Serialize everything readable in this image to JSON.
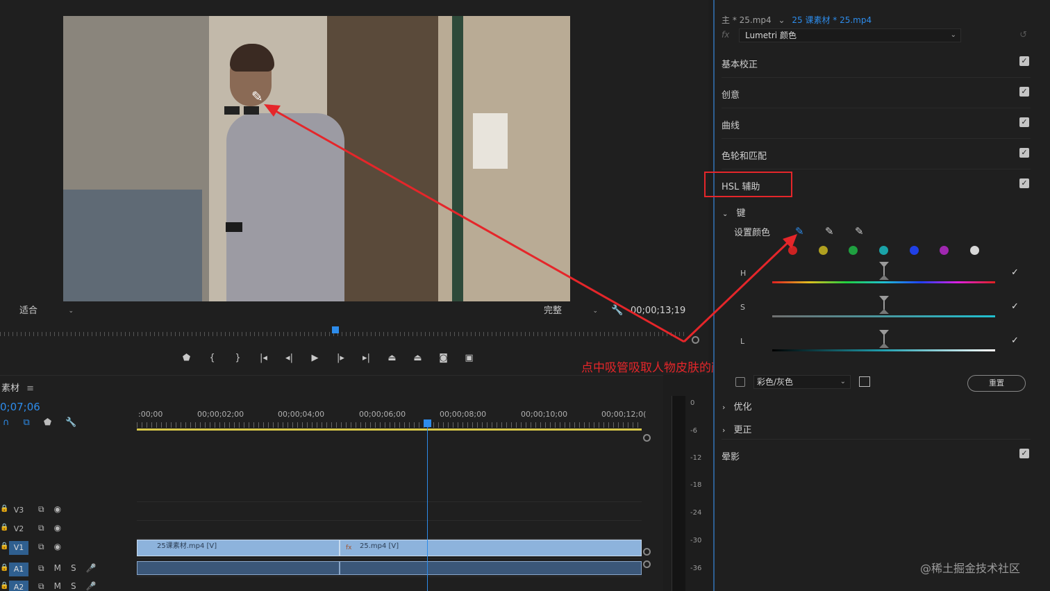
{
  "monitor": {
    "fit_label": "适合",
    "quality_label": "完整",
    "timecode": "00;00;13;19"
  },
  "annotation": {
    "text": "点中吸管吸取人物皮肤的颜色"
  },
  "transport": {
    "buttons": [
      "marker-icon",
      "in-point-icon",
      "out-point-icon",
      "go-to-in-icon",
      "step-back-icon",
      "play-icon",
      "step-forward-icon",
      "go-to-out-icon",
      "lift-icon",
      "extract-icon",
      "camera-icon",
      "compare-icon"
    ]
  },
  "timeline": {
    "title": "素材",
    "menu_glyph": "≡",
    "current_time": "0;07;06",
    "ruler_labels": [
      ":00;00",
      "00;00;02;00",
      "00;00;04;00",
      "00;00;06;00",
      "00;00;08;00",
      "00;00;10;00",
      "00;00;12;0("
    ],
    "meter_labels": [
      "0",
      "-6",
      "-12",
      "-18",
      "-24",
      "-30",
      "-36"
    ],
    "tracks": [
      {
        "name": "V3",
        "icons": [
          "⧉",
          "◉"
        ]
      },
      {
        "name": "V2",
        "icons": [
          "⧉",
          "◉"
        ]
      },
      {
        "name": "V1",
        "icons": [
          "⧉",
          "◉"
        ]
      },
      {
        "name": "A1",
        "icons": [
          "⧉",
          "M",
          "S",
          "🎤"
        ]
      },
      {
        "name": "A2",
        "icons": [
          "⧉",
          "M",
          "S",
          "🎤"
        ]
      }
    ],
    "clips": [
      {
        "label": "25课素材.mp4 [V]"
      },
      {
        "label": "25.mp4 [V]"
      }
    ]
  },
  "panel": {
    "header_master": "主 * 25.mp4",
    "header_clip": "25 课素材 * 25.mp4",
    "fx_label": "fx",
    "effect_name": "Lumetri 颜色",
    "sections": [
      {
        "label": "基本校正",
        "checked": true
      },
      {
        "label": "创意",
        "checked": true
      },
      {
        "label": "曲线",
        "checked": true
      },
      {
        "label": "色轮和匹配",
        "checked": true
      },
      {
        "label": "HSL 辅助",
        "checked": true
      }
    ],
    "key_label": "键",
    "set_color_label": "设置颜色",
    "swatches": [
      "#cc2222",
      "#b0a020",
      "#1fa040",
      "#1aa3a8",
      "#2040e6",
      "#a028b0",
      "#d8d8d8"
    ],
    "hsl": [
      {
        "letter": "H",
        "checked": true
      },
      {
        "letter": "S",
        "checked": true
      },
      {
        "letter": "L",
        "checked": true
      }
    ],
    "color_gray_label": "彩色/灰色",
    "reset_label": "重置",
    "refine_label": "优化",
    "correct_label": "更正",
    "vignette_label": "晕影",
    "vignette_checked": true
  },
  "watermark": "@稀土掘金技术社区",
  "colors": {
    "accent": "#2d8ceb",
    "annotation": "#e5262a",
    "clip": "#8db3dc"
  }
}
